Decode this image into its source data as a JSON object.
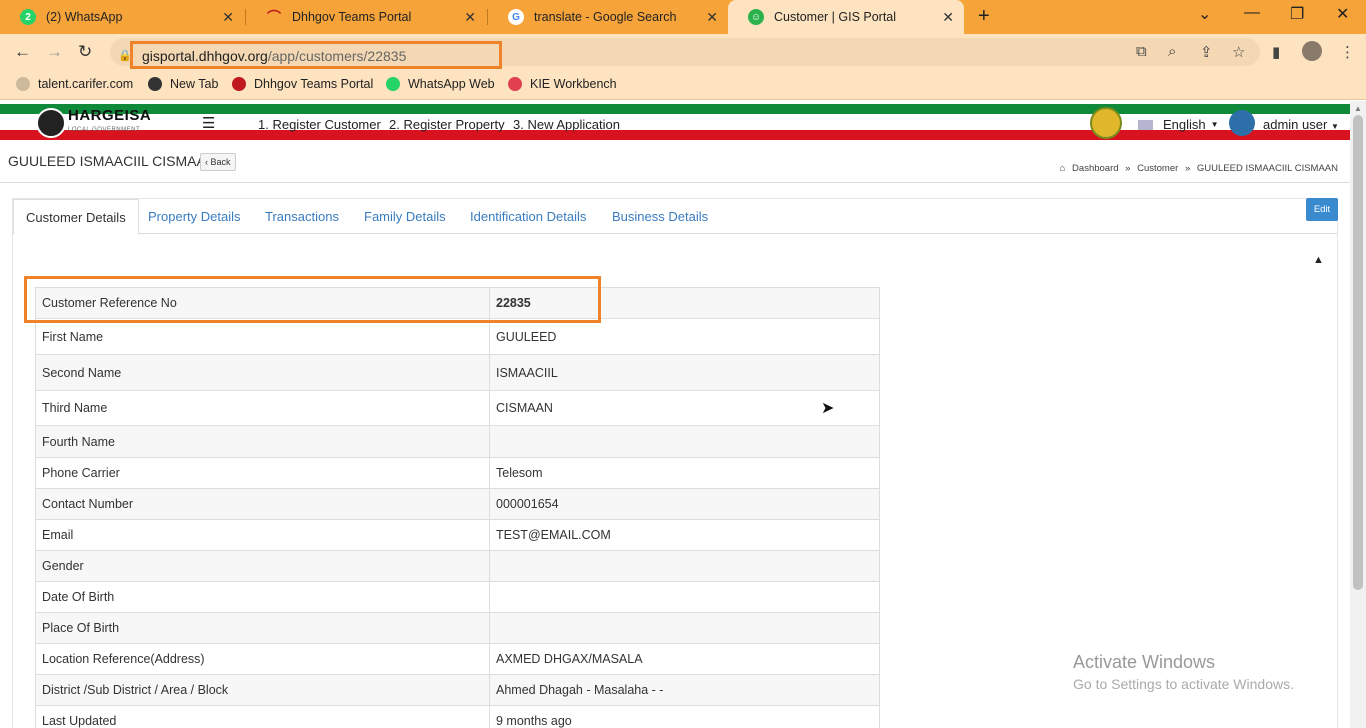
{
  "browser": {
    "tabs": [
      {
        "title": "(2) WhatsApp",
        "icon": "whatsapp-icon"
      },
      {
        "title": "Dhhgov Teams Portal",
        "icon": "teams-portal-icon"
      },
      {
        "title": "translate - Google Search",
        "icon": "google-icon"
      },
      {
        "title": "Customer | GIS Portal",
        "icon": "gis-portal-icon"
      }
    ],
    "url_host": "gisportal.dhhgov.org",
    "url_path": "/app/customers/22835",
    "bookmarks": [
      "talent.carifer.com",
      "New Tab",
      "Dhhgov Teams Portal",
      "WhatsApp Web",
      "KIE Workbench"
    ]
  },
  "header": {
    "logo_text": "HARGEISA",
    "logo_sub": "LOCAL GOVERNMENT",
    "menu": [
      "1. Register Customer",
      "2. Register Property",
      "3. New Application"
    ],
    "language": "English",
    "user": "admin user"
  },
  "page": {
    "title": "GUULEED ISMAACIIL CISMAAN",
    "back_label": "Back",
    "breadcrumb": [
      "Dashboard",
      "Customer",
      "GUULEED ISMAACIIL CISMAAN"
    ],
    "edit_label": "Edit"
  },
  "tabs": [
    "Customer Details",
    "Property Details",
    "Transactions",
    "Family Details",
    "Identification Details",
    "Business Details"
  ],
  "details": [
    {
      "label": "Customer Reference No",
      "value": "22835"
    },
    {
      "label": "First Name",
      "value": "GUULEED"
    },
    {
      "label": "Second Name",
      "value": "ISMAACIIL"
    },
    {
      "label": "Third Name",
      "value": "CISMAAN"
    },
    {
      "label": "Fourth Name",
      "value": ""
    },
    {
      "label": "Phone Carrier",
      "value": "Telesom"
    },
    {
      "label": "Contact Number",
      "value": "000001654"
    },
    {
      "label": "Email",
      "value": "TEST@EMAIL.COM"
    },
    {
      "label": "Gender",
      "value": ""
    },
    {
      "label": "Date Of Birth",
      "value": ""
    },
    {
      "label": "Place Of Birth",
      "value": ""
    },
    {
      "label": "Location Reference(Address)",
      "value": "AXMED DHGAX/MASALA"
    },
    {
      "label": "District /Sub District / Area / Block",
      "value": "Ahmed Dhagah - Masalaha - -"
    },
    {
      "label": "Last Updated",
      "value": "9 months ago"
    }
  ],
  "watermark": {
    "line1": "Activate Windows",
    "line2": "Go to Settings to activate Windows."
  }
}
